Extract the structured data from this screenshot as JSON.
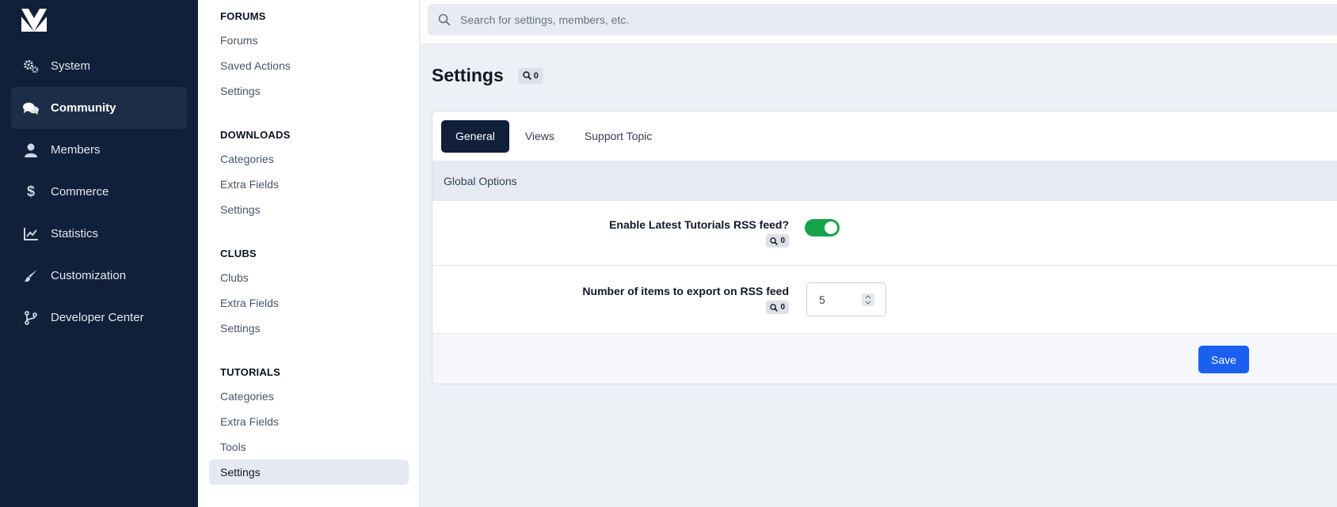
{
  "primary_nav": {
    "items": [
      {
        "label": "System",
        "icon": "gears-icon"
      },
      {
        "label": "Community",
        "icon": "comments-icon",
        "active": true
      },
      {
        "label": "Members",
        "icon": "user-icon"
      },
      {
        "label": "Commerce",
        "icon": "dollar-icon"
      },
      {
        "label": "Statistics",
        "icon": "line-chart-icon"
      },
      {
        "label": "Customization",
        "icon": "paint-brush-icon"
      },
      {
        "label": "Developer Center",
        "icon": "code-branch-icon"
      }
    ]
  },
  "secondary_nav": {
    "groups": [
      {
        "heading": "FORUMS",
        "items": [
          "Forums",
          "Saved Actions",
          "Settings"
        ]
      },
      {
        "heading": "DOWNLOADS",
        "items": [
          "Categories",
          "Extra Fields",
          "Settings"
        ]
      },
      {
        "heading": "CLUBS",
        "items": [
          "Clubs",
          "Extra Fields",
          "Settings"
        ]
      },
      {
        "heading": "TUTORIALS",
        "items": [
          "Categories",
          "Extra Fields",
          "Tools",
          "Settings"
        ],
        "active_index": 3
      }
    ]
  },
  "search": {
    "placeholder": "Search for settings, members, etc."
  },
  "page": {
    "title": "Settings",
    "search_count": "0",
    "tabs": [
      "General",
      "Views",
      "Support Topic"
    ],
    "active_tab": "General",
    "section_title": "Global Options",
    "settings": [
      {
        "label": "Enable Latest Tutorials RSS feed?",
        "search_count": "0",
        "type": "toggle",
        "enabled": true
      },
      {
        "label": "Number of items to export on RSS feed",
        "search_count": "0",
        "type": "number",
        "value": "5"
      }
    ],
    "save_label": "Save"
  },
  "colors": {
    "sidebar": "#10203a",
    "accent": "#1a5ff0",
    "toggle_on": "#16a34a"
  }
}
